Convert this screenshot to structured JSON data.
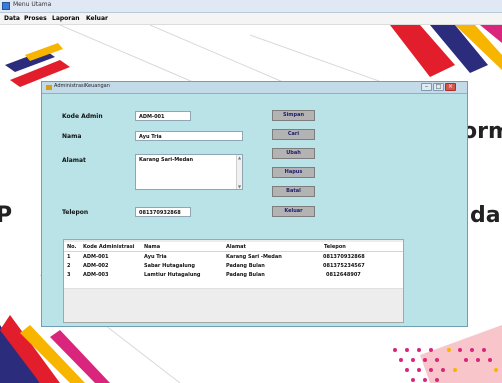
{
  "window": {
    "title": "Menu Utama"
  },
  "menu": [
    {
      "label": "Data"
    },
    {
      "label": "Proses"
    },
    {
      "label": "Laporan"
    },
    {
      "label": "Keluar"
    }
  ],
  "background": {
    "fragment_right_top": "orm",
    "fragment_left": "P",
    "fragment_right_mid": "da"
  },
  "dialog": {
    "title": "AdministrasiKeuangan",
    "controls": {
      "minimize": "–",
      "maximize": "□",
      "close": "×"
    },
    "form": {
      "kode_admin": {
        "label": "Kode Admin",
        "value": "ADM-001"
      },
      "nama": {
        "label": "Nama",
        "value": "Ayu Tria"
      },
      "alamat": {
        "label": "Alamat",
        "value": "Karang Sari-Medan"
      },
      "telepon": {
        "label": "Telepon",
        "value": "081370932868"
      }
    },
    "buttons": {
      "simpan": "Simpan",
      "cari": "Cari",
      "ubah": "Ubah",
      "hapus": "Hapus",
      "batal": "Batal",
      "keluar": "Keluar"
    },
    "table": {
      "columns": [
        "No.",
        "Kode Administrasi",
        "Nama",
        "Alamat",
        "Telepon"
      ],
      "rows": [
        [
          "1",
          "ADM-001",
          "Ayu Tria",
          "Karang Sari -Medan",
          "081370932868"
        ],
        [
          "2",
          "ADM-002",
          "Sabar Hutagalung",
          "Padang Bulan",
          "081375234567"
        ],
        [
          "3",
          "ADM-003",
          "Lamtiur Hutagalung",
          "Padang Bulan",
          "0812648907"
        ]
      ]
    }
  }
}
